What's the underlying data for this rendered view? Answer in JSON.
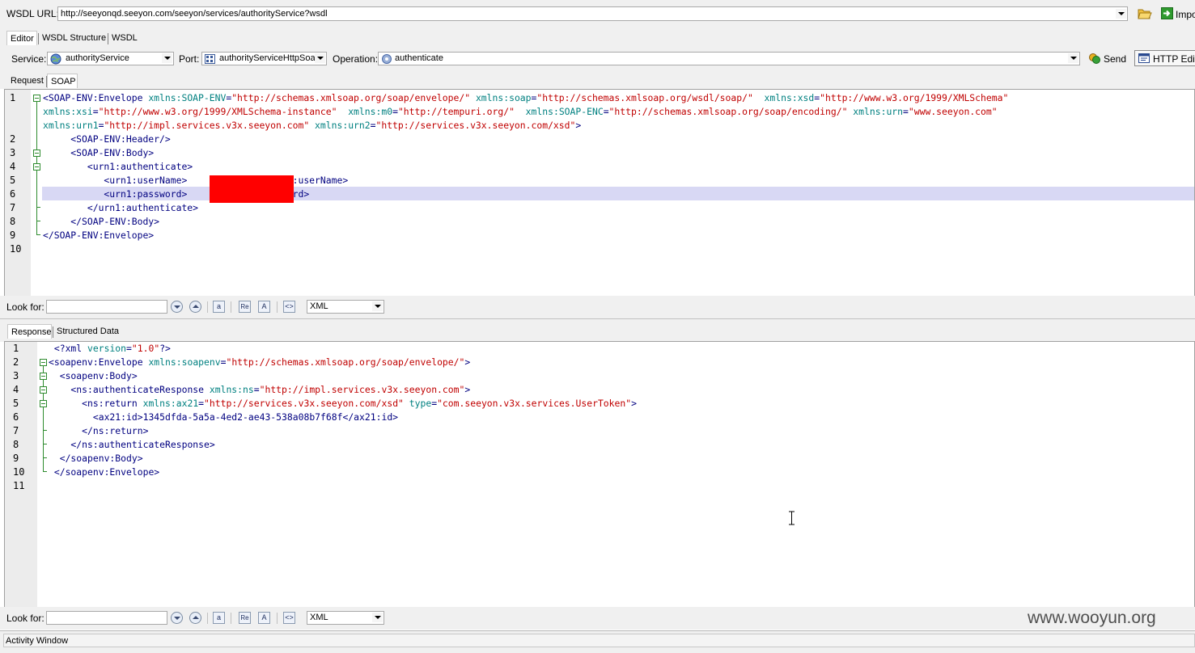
{
  "wsdl": {
    "label": "WSDL URL:",
    "url": "http://seeyonqd.seeyon.com/seeyon/services/authorityService?wsdl",
    "import_label": "Impo"
  },
  "main_tabs": [
    "Editor",
    "WSDL Structure",
    "WSDL"
  ],
  "service_row": {
    "service_label": "Service:",
    "service_value": "authorityService",
    "port_label": "Port:",
    "port_value": "authorityServiceHttpSoa",
    "operation_label": "Operation:",
    "operation_value": "authenticate",
    "send_label": "Send",
    "http_editor_label": "HTTP Edito"
  },
  "request_tabs": [
    "Request",
    "SOAP"
  ],
  "request_lines": [
    [
      [
        "t",
        "<SOAP-ENV:Envelope "
      ],
      [
        "a",
        "xmlns:SOAP-ENV"
      ],
      [
        "t",
        "="
      ],
      [
        "v",
        "\"http://schemas.xmlsoap.org/soap/envelope/\""
      ],
      [
        "t",
        " "
      ],
      [
        "a",
        "xmlns:soap"
      ],
      [
        "t",
        "="
      ],
      [
        "v",
        "\"http://schemas.xmlsoap.org/wsdl/soap/\""
      ],
      [
        "t",
        "  "
      ],
      [
        "a",
        "xmlns:xsd"
      ],
      [
        "t",
        "="
      ],
      [
        "v",
        "\"http://www.w3.org/1999/XMLSchema\""
      ]
    ],
    [
      [
        "a",
        "xmlns:xsi"
      ],
      [
        "t",
        "="
      ],
      [
        "v",
        "\"http://www.w3.org/1999/XMLSchema-instance\""
      ],
      [
        "t",
        "  "
      ],
      [
        "a",
        "xmlns:m0"
      ],
      [
        "t",
        "="
      ],
      [
        "v",
        "\"http://tempuri.org/\""
      ],
      [
        "t",
        "  "
      ],
      [
        "a",
        "xmlns:SOAP-ENC"
      ],
      [
        "t",
        "="
      ],
      [
        "v",
        "\"http://schemas.xmlsoap.org/soap/encoding/\""
      ],
      [
        "t",
        " "
      ],
      [
        "a",
        "xmlns:urn"
      ],
      [
        "t",
        "="
      ],
      [
        "v",
        "\"www.seeyon.com\""
      ]
    ],
    [
      [
        "a",
        "xmlns:urn1"
      ],
      [
        "t",
        "="
      ],
      [
        "v",
        "\"http://impl.services.v3x.seeyon.com\""
      ],
      [
        "t",
        " "
      ],
      [
        "a",
        "xmlns:urn2"
      ],
      [
        "t",
        "="
      ],
      [
        "v",
        "\"http://services.v3x.seeyon.com/xsd\""
      ],
      [
        "t",
        ">"
      ]
    ],
    [
      [
        "t",
        "     <SOAP-ENV:Header/>"
      ]
    ],
    [
      [
        "t",
        "     <SOAP-ENV:Body>"
      ]
    ],
    [
      [
        "t",
        "        <urn1:authenticate>"
      ]
    ],
    [
      [
        "t",
        "           <urn1:userName>             </urn1:userName>"
      ]
    ],
    [
      [
        "t",
        "           <urn1:password>             password>"
      ]
    ],
    [
      [
        "t",
        "        </urn1:authenticate>"
      ]
    ],
    [
      [
        "t",
        "     </SOAP-ENV:Body>"
      ]
    ],
    [
      [
        "t",
        "</SOAP-ENV:Envelope>"
      ]
    ],
    [
      [
        "t",
        ""
      ]
    ]
  ],
  "request_line_numbers": [
    "1",
    "",
    "",
    "2",
    "3",
    "4",
    "5",
    "6",
    "7",
    "8",
    "9",
    "10"
  ],
  "look_for": {
    "label": "Look for:",
    "format": "XML"
  },
  "response_tabs": [
    "Response",
    "Structured Data"
  ],
  "response_lines": [
    [
      [
        "t",
        " <?xml "
      ],
      [
        "a",
        "version"
      ],
      [
        "t",
        "="
      ],
      [
        "v",
        "\"1.0\""
      ],
      [
        "t",
        "?>"
      ]
    ],
    [
      [
        "t",
        "<soapenv:Envelope "
      ],
      [
        "a",
        "xmlns:soapenv"
      ],
      [
        "t",
        "="
      ],
      [
        "v",
        "\"http://schemas.xmlsoap.org/soap/envelope/\""
      ],
      [
        "t",
        ">"
      ]
    ],
    [
      [
        "t",
        "  <soapenv:Body>"
      ]
    ],
    [
      [
        "t",
        "    <ns:authenticateResponse "
      ],
      [
        "a",
        "xmlns:ns"
      ],
      [
        "t",
        "="
      ],
      [
        "v",
        "\"http://impl.services.v3x.seeyon.com\""
      ],
      [
        "t",
        ">"
      ]
    ],
    [
      [
        "t",
        "      <ns:return "
      ],
      [
        "a",
        "xmlns:ax21"
      ],
      [
        "t",
        "="
      ],
      [
        "v",
        "\"http://services.v3x.seeyon.com/xsd\""
      ],
      [
        "t",
        " "
      ],
      [
        "a",
        "type"
      ],
      [
        "t",
        "="
      ],
      [
        "v",
        "\"com.seeyon.v3x.services.UserToken\""
      ],
      [
        "t",
        ">"
      ]
    ],
    [
      [
        "t",
        "        <ax21:id>1345dfda-5a5a-4ed2-ae43-538a08b7f68f</ax21:id>"
      ]
    ],
    [
      [
        "t",
        "      </ns:return>"
      ]
    ],
    [
      [
        "t",
        "    </ns:authenticateResponse>"
      ]
    ],
    [
      [
        "t",
        "  </soapenv:Body>"
      ]
    ],
    [
      [
        "t",
        " </soapenv:Envelope>"
      ]
    ],
    [
      [
        "t",
        ""
      ]
    ]
  ],
  "response_line_numbers": [
    "1",
    "2",
    "3",
    "4",
    "5",
    "6",
    "7",
    "8",
    "9",
    "10",
    "11"
  ],
  "activity_window_label": "Activity Window",
  "watermark": "www.wooyun.org",
  "colors": {
    "tag": "#000080",
    "attr": "#008080",
    "value": "#c00000",
    "highlight": "#d8d8f4",
    "redaction": "#ff0000"
  }
}
